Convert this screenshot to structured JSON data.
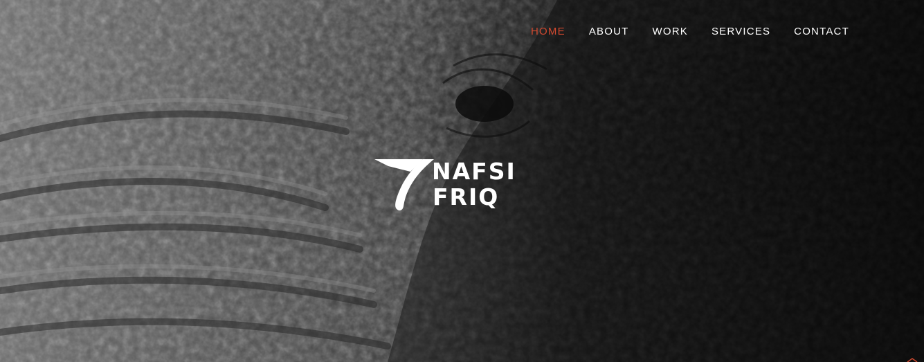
{
  "nav": {
    "items": [
      {
        "label": "HOME",
        "active": true
      },
      {
        "label": "ABOUT",
        "active": false
      },
      {
        "label": "WORK",
        "active": false
      },
      {
        "label": "SERVICES",
        "active": false
      },
      {
        "label": "CONTACT",
        "active": false
      }
    ],
    "active_color": "#d2492f",
    "text_color": "#ffffff"
  },
  "logo": {
    "line1": "NAFSI",
    "line2": "FRIQ",
    "icon": "stylized-a-arrow-icon"
  },
  "hero": {
    "background": "elephant-skin-photo"
  }
}
